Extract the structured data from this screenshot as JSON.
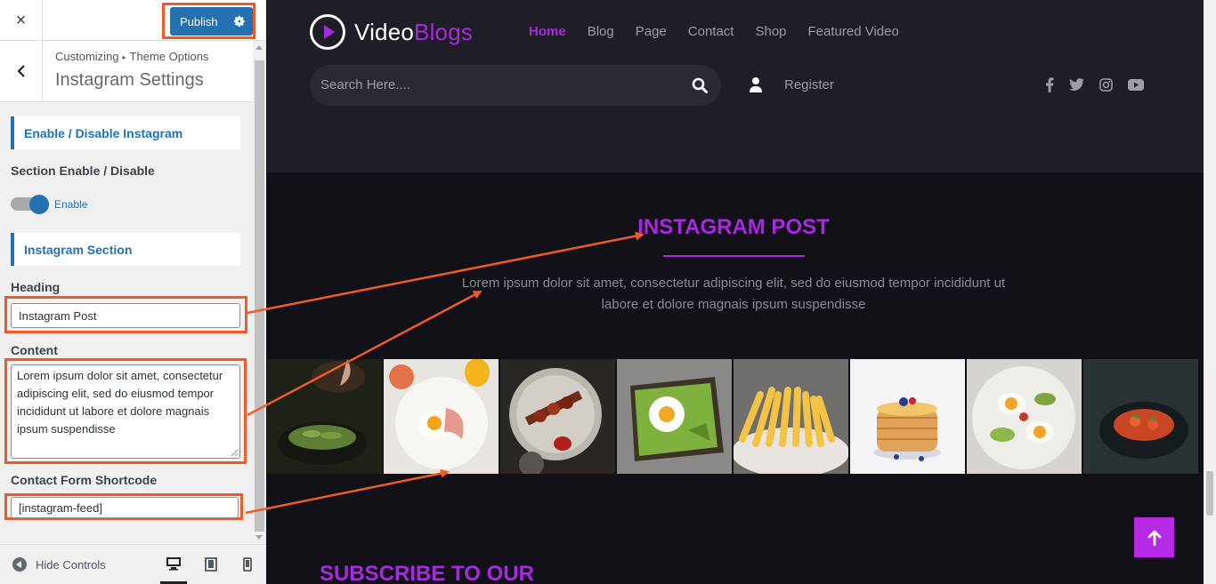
{
  "customizer": {
    "close_label": "×",
    "publish_label": "Publish",
    "breadcrumb": {
      "root": "Customizing",
      "parent": "Theme Options"
    },
    "title": "Instagram Settings",
    "sections": {
      "enable_disable": "Enable / Disable Instagram",
      "instagram_section": "Instagram Section"
    },
    "section_toggle": {
      "label": "Section Enable / Disable",
      "state_label": "Enable",
      "enabled": true
    },
    "heading": {
      "label": "Heading",
      "value": "Instagram Post"
    },
    "content": {
      "label": "Content",
      "value": "Lorem ipsum dolor sit amet, consectetur adipiscing elit, sed do eiusmod tempor incididunt ut labore et dolore magnais ipsum suspendisse"
    },
    "shortcode": {
      "label": "Contact Form Shortcode",
      "value": "[instagram-feed]"
    },
    "footer": {
      "hide_controls": "Hide Controls",
      "devices": [
        "desktop-icon",
        "tablet-icon",
        "mobile-icon"
      ],
      "active_device": "desktop"
    },
    "accent_color": "#2271b1",
    "highlight_color": "#f05a28"
  },
  "site": {
    "logo": {
      "text_main": "Video",
      "text_accent": "Blogs"
    },
    "nav": [
      "Home",
      "Blog",
      "Page",
      "Contact",
      "Shop",
      "Featured Video"
    ],
    "active_nav": "Home",
    "search_placeholder": "Search Here....",
    "register_label": "Register",
    "social_icons": [
      "facebook-icon",
      "twitter-icon",
      "instagram-icon",
      "youtube-icon"
    ],
    "instagram": {
      "title": "INSTAGRAM POST",
      "description": "Lorem ipsum dolor sit amet, consectetur adipiscing elit, sed do eiusmod tempor incididunt ut labore et dolore magnais ipsum suspendisse",
      "photos": [
        "green-beans",
        "eggs-and-ham",
        "grilled-skewers",
        "avocado-toast",
        "french-fries",
        "pancakes",
        "eggs-avocado-salad",
        "tomato-salad"
      ]
    },
    "subscribe_heading": "SUBSCRIBE TO OUR",
    "accent_color": "#a729e0"
  }
}
